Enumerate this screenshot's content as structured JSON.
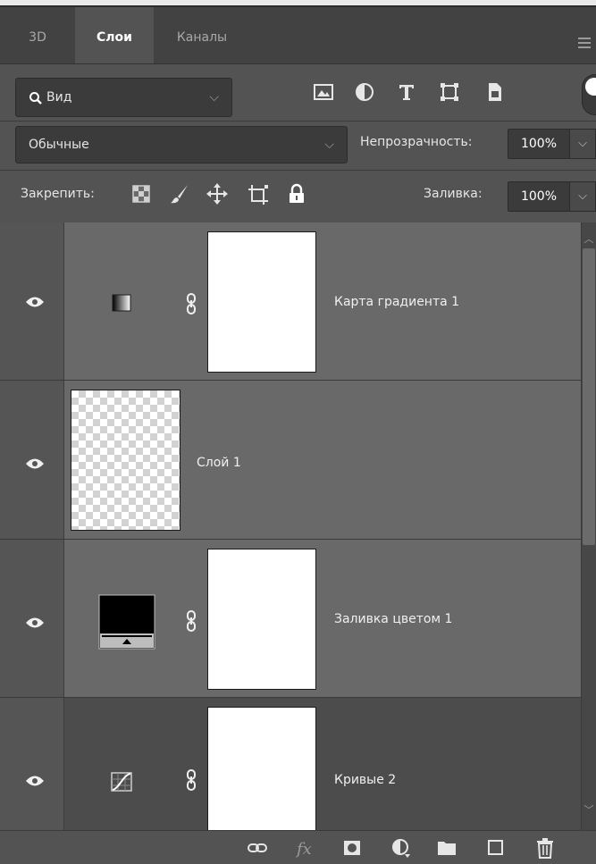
{
  "tabs": [
    {
      "label": "3D"
    },
    {
      "label": "Слои"
    },
    {
      "label": "Каналы"
    }
  ],
  "active_tab": "Слои",
  "filter": {
    "label": "Вид"
  },
  "blend": {
    "mode": "Обычные",
    "opacity_label": "Непрозрачность:",
    "opacity_value": "100%"
  },
  "lock": {
    "label": "Закрепить:",
    "fill_label": "Заливка:",
    "fill_value": "100%"
  },
  "layers": [
    {
      "name": "Карта градиента 1",
      "type": "adjustment-gradient-map",
      "visible": true
    },
    {
      "name": "Слой 1",
      "type": "pixel",
      "visible": true
    },
    {
      "name": "Заливка цветом 1",
      "type": "fill-solid-color",
      "visible": true
    },
    {
      "name": "Кривые 2",
      "type": "adjustment-curves",
      "visible": true
    }
  ],
  "colors": {
    "panel_bg": "#535353",
    "tabbar_bg": "#424242",
    "layer_selected": "#696969",
    "field_bg": "#3b3b3b"
  },
  "icons": {
    "filter": [
      "search-icon",
      "image-filter-icon",
      "adjustment-filter-icon",
      "type-filter-icon",
      "shape-filter-icon",
      "smart-object-filter-icon"
    ],
    "lock": [
      "lock-transparent-icon",
      "lock-image-brush-icon",
      "lock-position-move-icon",
      "lock-artboard-icon",
      "lock-all-icon"
    ],
    "bottom": [
      "link-layers-icon",
      "fx-icon",
      "add-mask-icon",
      "new-adjustment-icon",
      "new-group-icon",
      "new-layer-icon",
      "delete-icon"
    ]
  }
}
